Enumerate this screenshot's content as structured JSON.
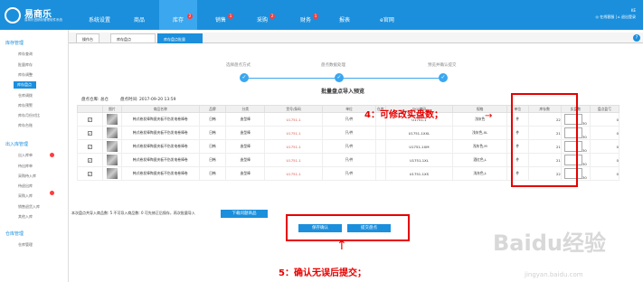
{
  "app": {
    "name": "易商乐",
    "sub": "易商乐进销存管理软件系统"
  },
  "nav": [
    {
      "label": "系统设置",
      "badge": ""
    },
    {
      "label": "商品",
      "badge": ""
    },
    {
      "label": "库存",
      "badge": "2"
    },
    {
      "label": "销售",
      "badge": "1"
    },
    {
      "label": "采购",
      "badge": "2"
    },
    {
      "label": "财务",
      "badge": "1"
    },
    {
      "label": "报表",
      "badge": ""
    },
    {
      "label": "e官网",
      "badge": ""
    }
  ],
  "user": {
    "id": "KE",
    "links": "◎ 在线客服 | ⌂ 退出登录"
  },
  "sidebar": {
    "section1": "库存管理",
    "items1": [
      "库存查询",
      "批量库存",
      "库存调整",
      "库存盘点",
      "仓库调拨",
      "库存预警",
      "库存月份对比",
      "库存台账"
    ],
    "section2": "出入库管理",
    "items2": [
      "出入库单",
      "待出库单",
      "采购待入库",
      "待退出库",
      "采购入库",
      "销售退货入库",
      "其他入库"
    ],
    "section3": "仓库管理",
    "items3": [
      "仓库管理"
    ]
  },
  "tabs": [
    "操作台",
    "库存盘点",
    "库存盘点批量"
  ],
  "steps": [
    "选择盘点方式",
    "盘点数据处理",
    "预览并确认提交"
  ],
  "title": "批量盘点导入预览",
  "info": {
    "warehouse": "盘点仓库: 总仓",
    "time": "盘点时间: 2017-09-20 13:59"
  },
  "headers": [
    "",
    "图片",
    "商品名称",
    "品牌",
    "分类",
    "货号/条码",
    "单位",
    "仓库",
    "SKU编码",
    "规格",
    "单位",
    "库存数",
    "实盘数",
    "盘点盈亏"
  ],
  "rows": [
    {
      "name": "韩式卷发棒陶瓷夹板不伤发电卷棒卷",
      "brand": "日韩",
      "cat": "造型棒",
      "code": "U1751-1",
      "unit": "只/件",
      "sku": "U1751-1",
      "spec": "浅灰色",
      "u2": "件",
      "stock": "22",
      "actual": "30",
      "diff": "0"
    },
    {
      "name": "韩式卷发棒陶瓷夹板不伤发电卷棒卷",
      "brand": "日韩",
      "cat": "造型棒",
      "code": "U1751-1",
      "unit": "只/件",
      "sku": "U1751-1XXL",
      "spec": "浅灰色,XL",
      "u2": "件",
      "stock": "21",
      "actual": "30",
      "diff": "0"
    },
    {
      "name": "韩式卷发棒陶瓷夹板不伤发电卷棒卷",
      "brand": "日韩",
      "cat": "造型棒",
      "code": "U1751-1",
      "unit": "只/件",
      "sku": "U1751-1XM",
      "spec": "浅灰色,M",
      "u2": "件",
      "stock": "21",
      "actual": "30",
      "diff": "0"
    },
    {
      "name": "韩式卷发棒陶瓷夹板不伤发电卷棒卷",
      "brand": "日韩",
      "cat": "造型棒",
      "code": "U1751-1",
      "unit": "只/件",
      "sku": "U1751-1XL",
      "spec": "酒红色,L",
      "u2": "件",
      "stock": "21",
      "actual": "30",
      "diff": "0"
    },
    {
      "name": "韩式卷发棒陶瓷夹板不伤发电卷棒卷",
      "brand": "日韩",
      "cat": "造型棒",
      "code": "U1751-1",
      "unit": "只/件",
      "sku": "U1751-1XS",
      "spec": "浅灰色,L",
      "u2": "件",
      "stock": "22",
      "actual": "30",
      "diff": "0"
    }
  ],
  "summary": "本次盘点共导入商品数: 5 不可导入商品数: 0 可先修正后保存，再次批量导入",
  "download_btn": "下载问题商品",
  "buttons": {
    "prev": "保存确认",
    "submit": "提交盘点"
  },
  "annotations": {
    "a1": "4：可修改实盘数；",
    "a2": "5：确认无误后提交；"
  },
  "watermark": {
    "w1": "Baidu经验",
    "w2": "jingyan.baidu.com"
  },
  "colors": {
    "primary": "#1b8fdc",
    "annotation": "#e60000"
  }
}
